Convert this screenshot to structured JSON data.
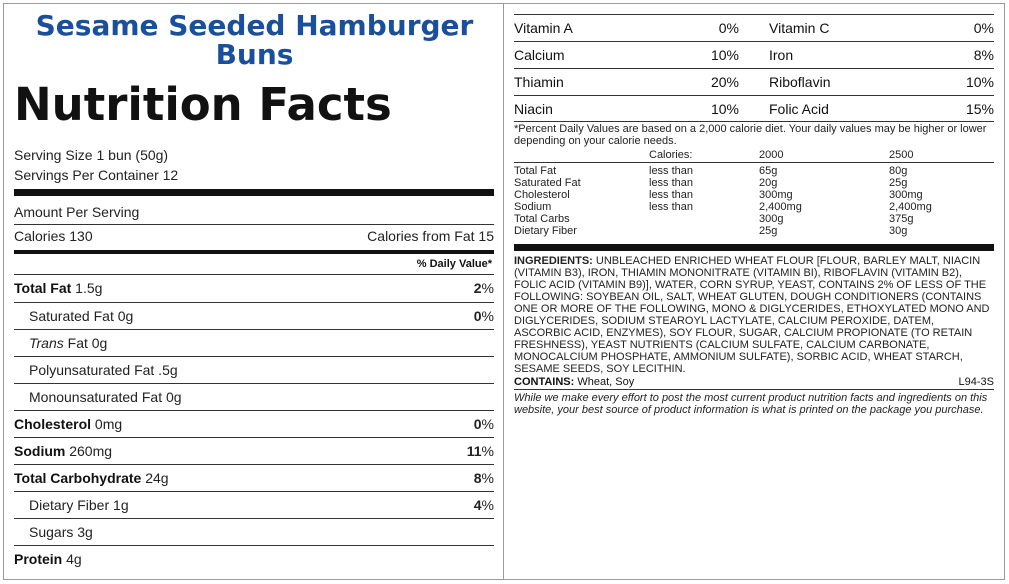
{
  "product": {
    "title": "Sesame Seeded Hamburger Buns"
  },
  "label": {
    "heading": "Nutrition Facts",
    "serving_size": "Serving Size 1 bun (50g)",
    "servings_per_container": "Servings Per Container 12",
    "amount_per_serving": "Amount Per Serving",
    "calories": "Calories 130",
    "calories_from_fat": "Calories from Fat 15",
    "daily_value_header": "% Daily Value*",
    "nutrients": [
      {
        "name": "Total Fat",
        "amount": " 1.5g",
        "dv": "2",
        "pct": "%"
      },
      {
        "name": "Saturated Fat",
        "amount": " 0g",
        "dv": "0",
        "pct": "%"
      },
      {
        "name": "Trans",
        "amount": " Fat 0g",
        "dv": "",
        "pct": ""
      },
      {
        "name": "Polyunsaturated Fat",
        "amount": " .5g",
        "dv": "",
        "pct": ""
      },
      {
        "name": "Monounsaturated Fat",
        "amount": " 0g",
        "dv": "",
        "pct": ""
      },
      {
        "name": "Cholesterol",
        "amount": " 0mg",
        "dv": "0",
        "pct": "%"
      },
      {
        "name": "Sodium",
        "amount": " 260mg",
        "dv": "11",
        "pct": "%"
      },
      {
        "name": "Total Carbohydrate",
        "amount": " 24g",
        "dv": "8",
        "pct": "%"
      },
      {
        "name": "Dietary Fiber",
        "amount": " 1g",
        "dv": "4",
        "pct": "%"
      },
      {
        "name": "Sugars",
        "amount": " 3g",
        "dv": "",
        "pct": ""
      },
      {
        "name": "Protein",
        "amount": " 4g",
        "dv": "",
        "pct": ""
      }
    ]
  },
  "vitamins": [
    {
      "name": "Vitamin A",
      "value": "0%",
      "name2": "Vitamin C",
      "value2": "0%"
    },
    {
      "name": "Calcium",
      "value": "10%",
      "name2": "Iron",
      "value2": "8%"
    },
    {
      "name": "Thiamin",
      "value": "20%",
      "name2": "Riboflavin",
      "value2": "10%"
    },
    {
      "name": "Niacin",
      "value": "10%",
      "name2": "Folic Acid",
      "value2": "15%"
    }
  ],
  "footnote": "*Percent Daily Values are based on a 2,000 calorie diet. Your daily values may be higher or lower depending on your calorie needs.",
  "dv_table": {
    "header": [
      "",
      "Calories:",
      "2000",
      "2500"
    ],
    "rows": [
      [
        "Total Fat",
        "less than",
        "65g",
        "80g"
      ],
      [
        "Saturated Fat",
        "less than",
        "20g",
        "25g"
      ],
      [
        "Cholesterol",
        "less than",
        "300mg",
        "300mg"
      ],
      [
        "Sodium",
        "less than",
        "2,400mg",
        "2,400mg"
      ],
      [
        "Total Carbs",
        "",
        "300g",
        "375g"
      ],
      [
        "Dietary Fiber",
        "",
        "25g",
        "30g"
      ]
    ]
  },
  "ingredients": {
    "label": "INGREDIENTS:",
    "text": " UNBLEACHED ENRICHED WHEAT FLOUR [FLOUR, BARLEY MALT, NIACIN (VITAMIN B3), IRON, THIAMIN MONONITRATE (VITAMIN BI), RIBOFLAVIN (VITAMIN B2), FOLIC ACID (VITAMIN B9)], WATER, CORN SYRUP, YEAST, CONTAINS 2% OF LESS OF THE FOLLOWING: SOYBEAN OIL, SALT, WHEAT GLUTEN, DOUGH CONDITIONERS (CONTAINS ONE OR MORE OF THE FOLLOWING, MONO & DIGLYCERIDES, ETHOXYLATED MONO AND DIGLYCERIDES, SODIUM STEAROYL LACTYLATE, CALCIUM PEROXIDE, DATEM, ASCORBIC ACID, ENZYMES), SOY FLOUR, SUGAR, CALCIUM PROPIONATE (TO RETAIN FRESHNESS), YEAST NUTRIENTS (CALCIUM SULFATE, CALCIUM CARBONATE, MONOCALCIUM PHOSPHATE, AMMONIUM SULFATE), SORBIC ACID, WHEAT STARCH, SESAME SEEDS, SOY LECITHIN."
  },
  "contains": {
    "label": "CONTAINS:",
    "text": " Wheat, Soy",
    "code": "L94-3S"
  },
  "disclaimer": "While we make every effort to post the most current product nutrition facts and ingredients on this website, your best source of product information is what is printed on the package you purchase."
}
